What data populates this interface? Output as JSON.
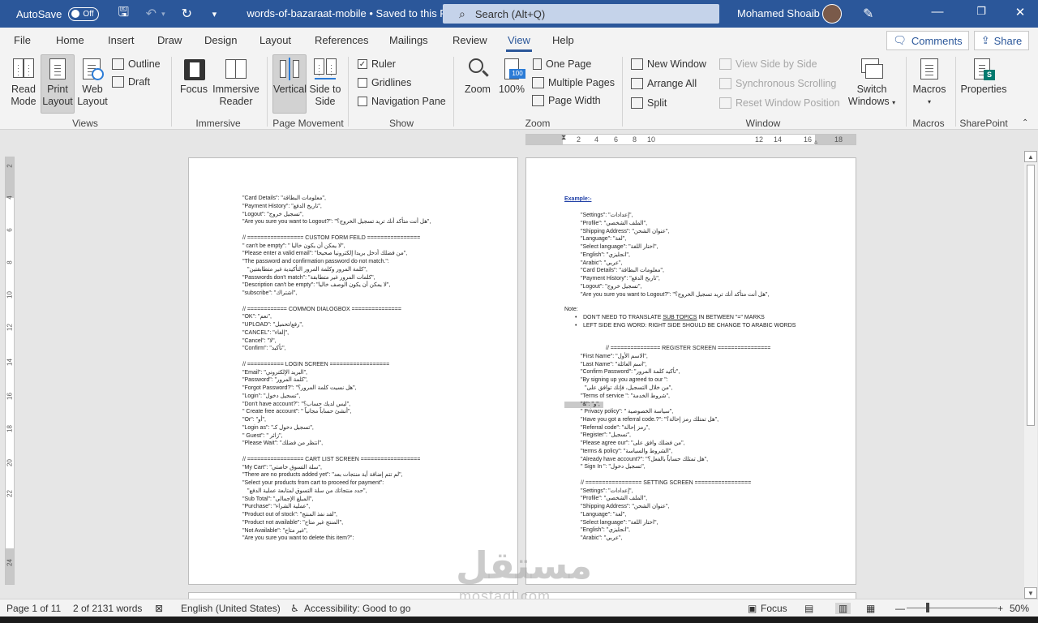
{
  "titlebar": {
    "autosave_label": "AutoSave",
    "autosave_state": "Off",
    "doc_name": "words-of-bazaraat-mobile • Saved to this PC",
    "dropdown_glyph": "⌄",
    "search_placeholder": "Search (Alt+Q)",
    "user_name": "Mohamed Shoaib"
  },
  "tabs": [
    "File",
    "Home",
    "Insert",
    "Draw",
    "Design",
    "Layout",
    "References",
    "Mailings",
    "Review",
    "View",
    "Help"
  ],
  "active_tab": "View",
  "actions": {
    "comments": "Comments",
    "share": "Share"
  },
  "ribbon": {
    "views": {
      "label": "Views",
      "read_mode": "Read Mode",
      "print_layout": "Print Layout",
      "web_layout": "Web Layout",
      "outline": "Outline",
      "draft": "Draft"
    },
    "immersive": {
      "label": "Immersive",
      "focus": "Focus",
      "immersive_reader": "Immersive Reader"
    },
    "page_movement": {
      "label": "Page Movement",
      "vertical": "Vertical",
      "side_to_side": "Side to Side"
    },
    "show": {
      "label": "Show",
      "ruler": "Ruler",
      "ruler_checked": true,
      "gridlines": "Gridlines",
      "navigation_pane": "Navigation Pane"
    },
    "zoom": {
      "label": "Zoom",
      "zoom": "Zoom",
      "hundred": "100%",
      "icon_text": "100",
      "one_page": "One Page",
      "multiple_pages": "Multiple Pages",
      "page_width": "Page Width"
    },
    "window": {
      "label": "Window",
      "new_window": "New Window",
      "arrange_all": "Arrange All",
      "split": "Split",
      "view_side_by_side": "View Side by Side",
      "sync_scrolling": "Synchronous Scrolling",
      "reset_window": "Reset Window Position",
      "switch_windows": "Switch Windows"
    },
    "macros": {
      "label": "Macros",
      "macros": "Macros"
    },
    "sharepoint": {
      "label": "SharePoint",
      "properties": "Properties"
    }
  },
  "ruler_numbers": [
    "2",
    "4",
    "6",
    "8",
    "10",
    "12",
    "14",
    "16",
    "18"
  ],
  "vruler_numbers": [
    "2",
    "4",
    "6",
    "8",
    "10",
    "12",
    "14",
    "16",
    "18",
    "20",
    "22",
    "24"
  ],
  "page_left": [
    "\"Card Details\": \"معلومات البطاقة\",",
    "\"Payment History\": \"تاريخ الدفع\",",
    "\"Logout\": \"تسجيل خروج\",",
    "\"Are you sure you want to Logout?\":   \"هل أنت متأكد أنك تريد تسجيل الخروج؟\",",
    "",
    "// ================= CUSTOM FORM FEILD ================",
    "\" can't be empty\": \" لا يمكن أن يكون خاليا\",",
    "\"Please enter a valid email\": \"من فضلك أدخل بريدا إلكترونيا صحيحا\",",
    "\"The password and confirmation password do not match.\":",
    "      \"كلمة المرور وكلمة المرور التأكيدية غير متطابقتين\",",
    "\"Passwords don't match\": \"كلمات المرور غير متطابقة\",",
    "\"Description can't be empty\": \"لا يمكن أن يكون الوصف خاليا\",",
    "\"subscribe\": \"اشتراك\",",
    "",
    "// ============ COMMON DIALOGBOX ===============",
    "\"OK\": \"نعم\",",
    "\"UPLOAD\": \"رفع/تحميل\",",
    "\"CANCEL\": \"إلغاء\",",
    "\"Cancel\": \"لا\",",
    "\"Confirm\": \"تأكيد\",",
    "",
    "// =========== LOGIN SCREEN ==================",
    "\"Email\": \"البريد الإلكتروني\",",
    "\"Password\": \"كلمة المرور\",",
    "\"Forgot Password?\": \"هل نسيت كلمة المرور؟\",",
    "\"Login\": \"تسجيل دخول\",",
    "\"Don't have account?\": \"ليس لديك حساب؟\",",
    "\" Create free account\": \" أنشئ حساباً مجانياً\",",
    "\"Or\": \"أو\",",
    "\"Login as\": \"تسجيل دخول كـ\",",
    "\" Guest\": \" زائر\",",
    "\"Please Wait\": \"انتظر من فضلك\",",
    "",
    "// ================= CART LIST SCREEN ==================",
    "\"My Cart\": \"سلة التسوق خاصتي\",",
    "\"There are no products added yet\": \"لم تتم إضافة أية منتجات بعد\",",
    "\"Select your products from cart to proceed for payment\":",
    "   \"حدد منتجاتك من سلة التسوق لمتابعة عملية الدفع\",",
    "\"Sub Total\": \"المبلغ الإجمالي\",",
    "\"Purchase\": \"عملية الشراء\",",
    "\"Product out of stock\": \"لقد نفذ المنتج\",",
    "\"Product not available\": \"المنتج غير متاح\",",
    "\"Not Available\": \"غير متاح\",",
    "\"Are you sure you want to delete this item?\":"
  ],
  "page_right": {
    "example_label": "Example:-",
    "example_lines": [
      "\"Settings\": \"إعدادات\",",
      "\"Profile\": \"الملف الشخصي\",",
      "\"Shipping Address\": \"عنوان الشحن\",",
      "\"Language\": \"لغة\",",
      "\"Select language\": \"اختار اللغة\",",
      "\"English\": \"انجليزي\",",
      "\"Arabic\": \"عربي\",",
      "\"Card Details\": \"معلومات البطاقة\",",
      "\"Payment History\": \"تاريخ الدفع\",",
      "\"Logout\": \"تسجيل خروج\",",
      "\"Are you sure you want to Logout?\":   \"هل أنت متأكد أنك تريد تسجيل الخروج؟\","
    ],
    "note_label": "Note:",
    "note_1_pre": "DON'T NEED TO TRANSLATE ",
    "note_1_link": "SUB TOPICS",
    "note_1_post": " IN BETWEEN \"=\" MARKS",
    "note_2": "LEFT SIDE ENG WORD: RIGHT SIDE SHOULD BE CHANGE TO ARABIC WORDS",
    "register_lines": [
      "// =============== REGISTER SCREEN ================",
      "\"First Name\": \"الاسم الأول\",",
      "\"Last Name\": \"اسم العائلة\",",
      "\"Confirm Password\": \"تأكيد كلمة المرور\",",
      "\"By signing up you agreed to our \":",
      "      \"من خلال التسجيل، فإنك توافق على\",",
      "\"Terms of service \": \"شروط الخدمة\","
    ],
    "highlight_line": "\"&\": \"و\",",
    "register_lines_2": [
      "\" Privacy policy\": \" سياسة الخصوصية\",",
      "\"Have you got a referral code.?\": \"هل تمتلك رمز إحالة؟\",",
      "\"Referral code\": \"رمز إحالة\",",
      "\"Register\": \"تسجيل\",",
      "\"Please agree our\": \"من فضلك وافق على\",",
      "\"terms & policy\": \"الشروط والسياسة\",",
      "\"Already have account?\": \"هل تمتلك حساباً بالفعل؟\",",
      "\" Sign In \": \"تسجيل دخول\",",
      "",
      "// ================= SETTING SCREEN =================",
      "\"Settings\": \"إعدادات\",",
      "\"Profile\": \"الملف الشخصي\",",
      "\"Shipping Address\": \"عنوان الشحن\",",
      "\"Language\": \"لغة\",",
      "\"Select language\": \"اختار اللغة\",",
      "\"English\": \"انجليزي\",",
      "\"Arabic\": \"عربي\","
    ]
  },
  "status": {
    "page": "Page 1 of 11",
    "words": "2 of 2131 words",
    "language": "English (United States)",
    "accessibility": "Accessibility: Good to go",
    "focus": "Focus",
    "zoom": "50%"
  },
  "watermark": {
    "arabic": "مستقل",
    "latin": "mostaql.com"
  }
}
